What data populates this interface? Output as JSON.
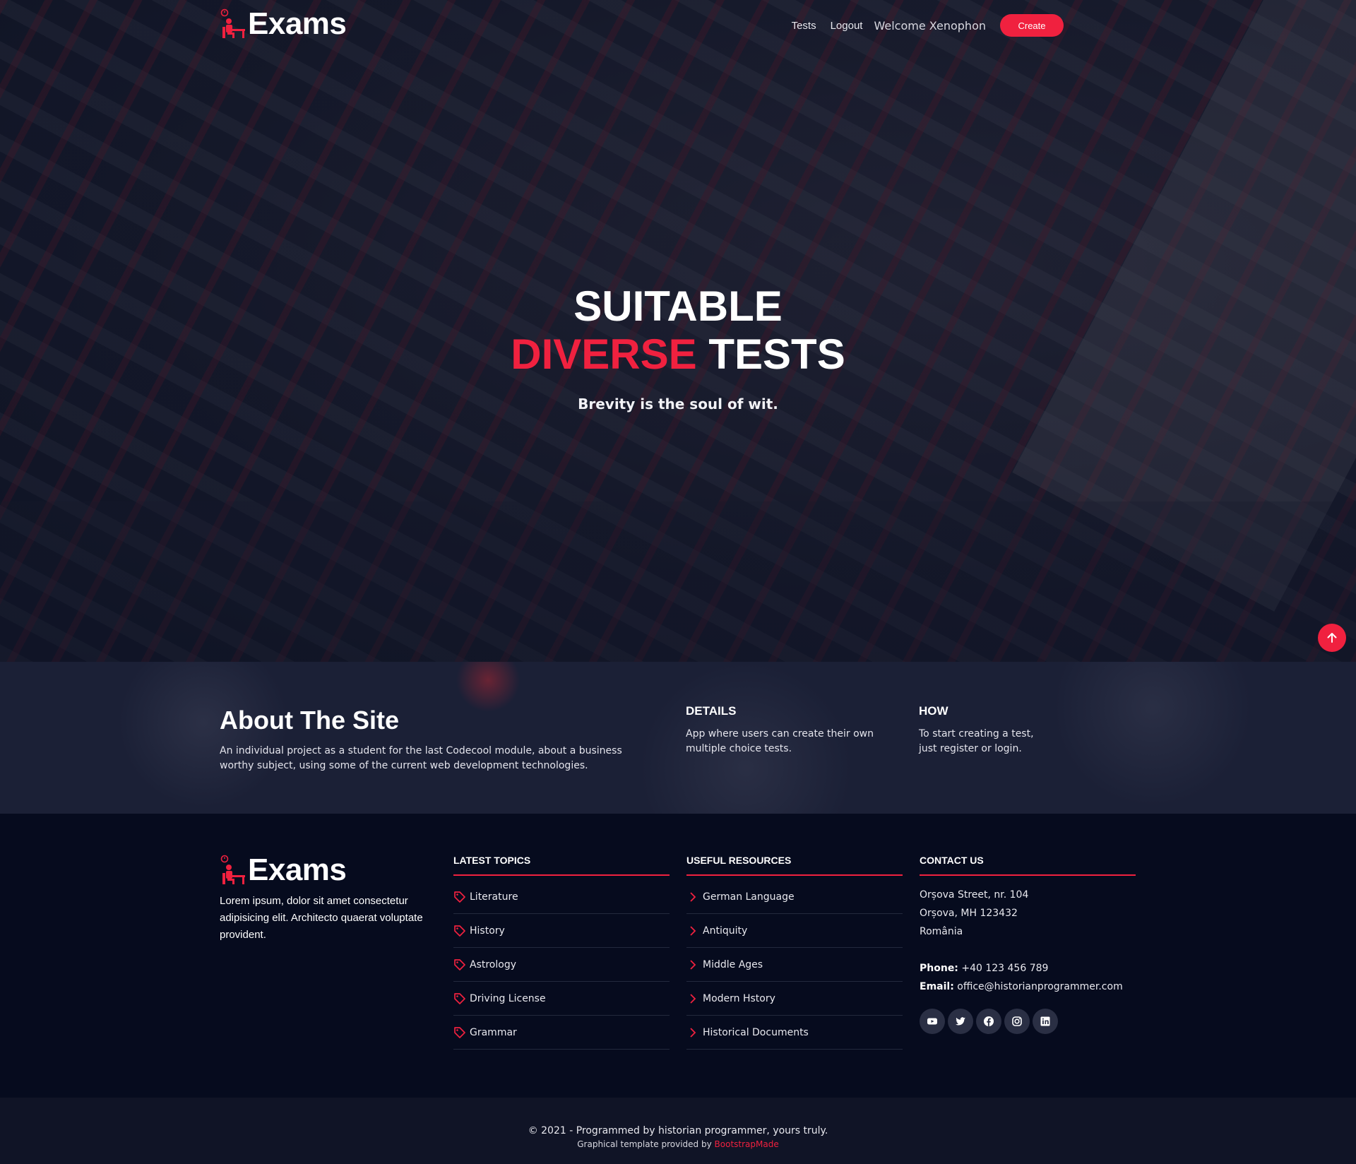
{
  "brand": {
    "name": "Exams"
  },
  "nav": {
    "tests": "Tests",
    "logout": "Logout",
    "welcome": "Welcome Xenophon",
    "create": "Create"
  },
  "hero": {
    "line1": "SUITABLE",
    "line2_accent": "DIVERSE",
    "line2_rest": "TESTS",
    "subtitle": "Brevity is the soul of wit."
  },
  "about": {
    "title": "About The Site",
    "text": "An individual project as a student for the last Codecool module, about a business worthy subject, using some of the current web development technologies.",
    "details_title": "DETAILS",
    "details_text": "App where users can create their own multiple choice tests.",
    "how_title": "HOW",
    "how_text": "To start creating a test, just register or login."
  },
  "footer": {
    "about_text": "Lorem ipsum, dolor sit amet consectetur adipisicing elit. Architecto quaerat voluptate provident.",
    "topics_title": "LATEST TOPICS",
    "topics": [
      "Literature",
      "History",
      "Astrology",
      "Driving License",
      "Grammar"
    ],
    "resources_title": "USEFUL RESOURCES",
    "resources": [
      "German Language",
      "Antiquity",
      "Middle Ages",
      "Modern Hstory",
      "Historical Documents"
    ],
    "contact_title": "CONTACT US",
    "address1": "Orșova Street, nr. 104",
    "address2": "Orșova, MH 123432",
    "address3": "România",
    "phone_label": "Phone:",
    "phone": "+40 123 456 789",
    "email_label": "Email:",
    "email": "office@historianprogrammer.com",
    "socials": [
      "youtube-icon",
      "twitter-icon",
      "facebook-icon",
      "instagram-icon",
      "linkedin-icon"
    ]
  },
  "bottom": {
    "copyright": "© 2021 - Programmed by historian programmer, yours truly.",
    "credits_prefix": "Graphical template provided by",
    "credits_link": "BootstrapMade"
  },
  "colors": {
    "accent": "#f0213f",
    "footer_bg": "#060b1e"
  }
}
